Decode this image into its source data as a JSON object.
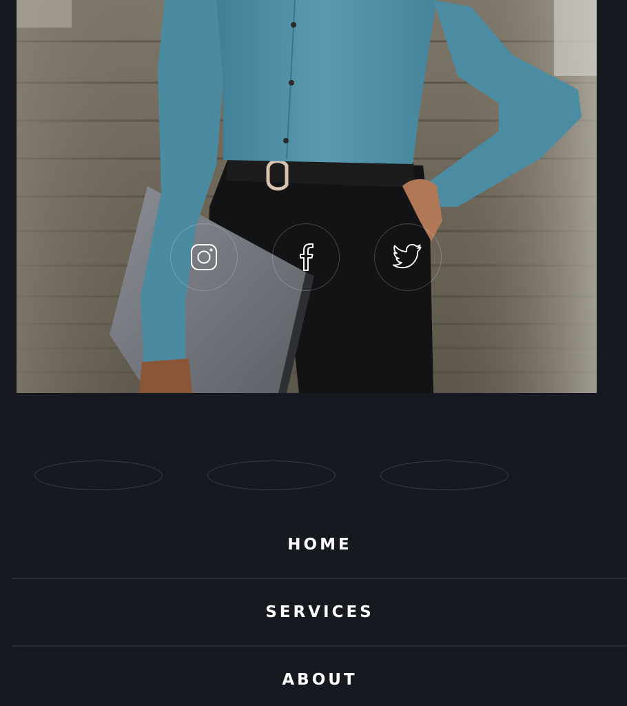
{
  "hero": {
    "image_icon": "woman-with-laptop-photo",
    "social_links": [
      {
        "name": "instagram",
        "icon": "instagram-icon"
      },
      {
        "name": "facebook",
        "icon": "facebook-icon"
      },
      {
        "name": "twitter",
        "icon": "twitter-icon"
      }
    ]
  },
  "nav": {
    "items": [
      {
        "label": "HOME"
      },
      {
        "label": "SERVICES"
      },
      {
        "label": "ABOUT"
      }
    ]
  },
  "colors": {
    "background": "#171920",
    "text": "#ffffff",
    "divider": "#2b2e36",
    "sweater": "#4f8ea5"
  }
}
